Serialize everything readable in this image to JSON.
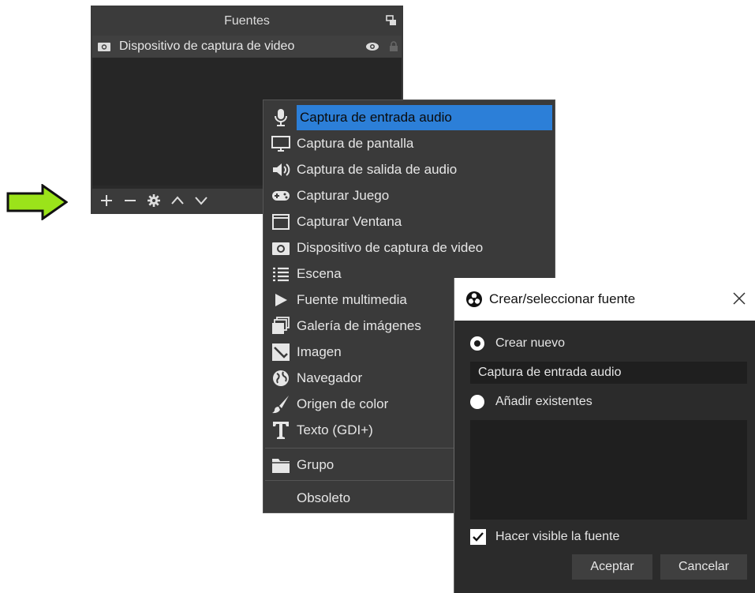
{
  "dock": {
    "title": "Fuentes",
    "source_item": "Dispositivo de captura de video",
    "float_icon": "float-window-icon",
    "toolbar_icons": [
      "plus-icon",
      "minus-icon",
      "gear-icon",
      "chevron-up-icon",
      "chevron-down-icon"
    ]
  },
  "menu": {
    "items": [
      {
        "label": "Captura de entrada audio",
        "icon": "microphone-icon",
        "active": true
      },
      {
        "label": "Captura de pantalla",
        "icon": "monitor-icon"
      },
      {
        "label": "Captura de salida de audio",
        "icon": "speaker-icon"
      },
      {
        "label": "Capturar Juego",
        "icon": "gamepad-icon"
      },
      {
        "label": "Capturar Ventana",
        "icon": "window-icon"
      },
      {
        "label": "Dispositivo de captura de video",
        "icon": "camera-icon"
      },
      {
        "label": "Escena",
        "icon": "list-icon"
      },
      {
        "label": "Fuente multimedia",
        "icon": "play-icon"
      },
      {
        "label": "Galería de imágenes",
        "icon": "gallery-icon"
      },
      {
        "label": "Imagen",
        "icon": "image-icon"
      },
      {
        "label": "Navegador",
        "icon": "globe-icon"
      },
      {
        "label": "Origen de color",
        "icon": "brush-icon"
      },
      {
        "label": "Texto (GDI+)",
        "icon": "text-icon"
      },
      {
        "label": "Grupo",
        "icon": "folder-icon"
      },
      {
        "label": "Obsoleto",
        "icon": ""
      }
    ]
  },
  "dialog": {
    "title": "Crear/seleccionar fuente",
    "create_new_label": "Crear nuevo",
    "name_value": "Captura de entrada audio",
    "add_existing_label": "Añadir existentes",
    "visible_label": "Hacer visible la fuente",
    "accept_label": "Aceptar",
    "cancel_label": "Cancelar"
  },
  "colors": {
    "highlight": "#2c7fd8",
    "arrow_fill": "#9be31a"
  }
}
